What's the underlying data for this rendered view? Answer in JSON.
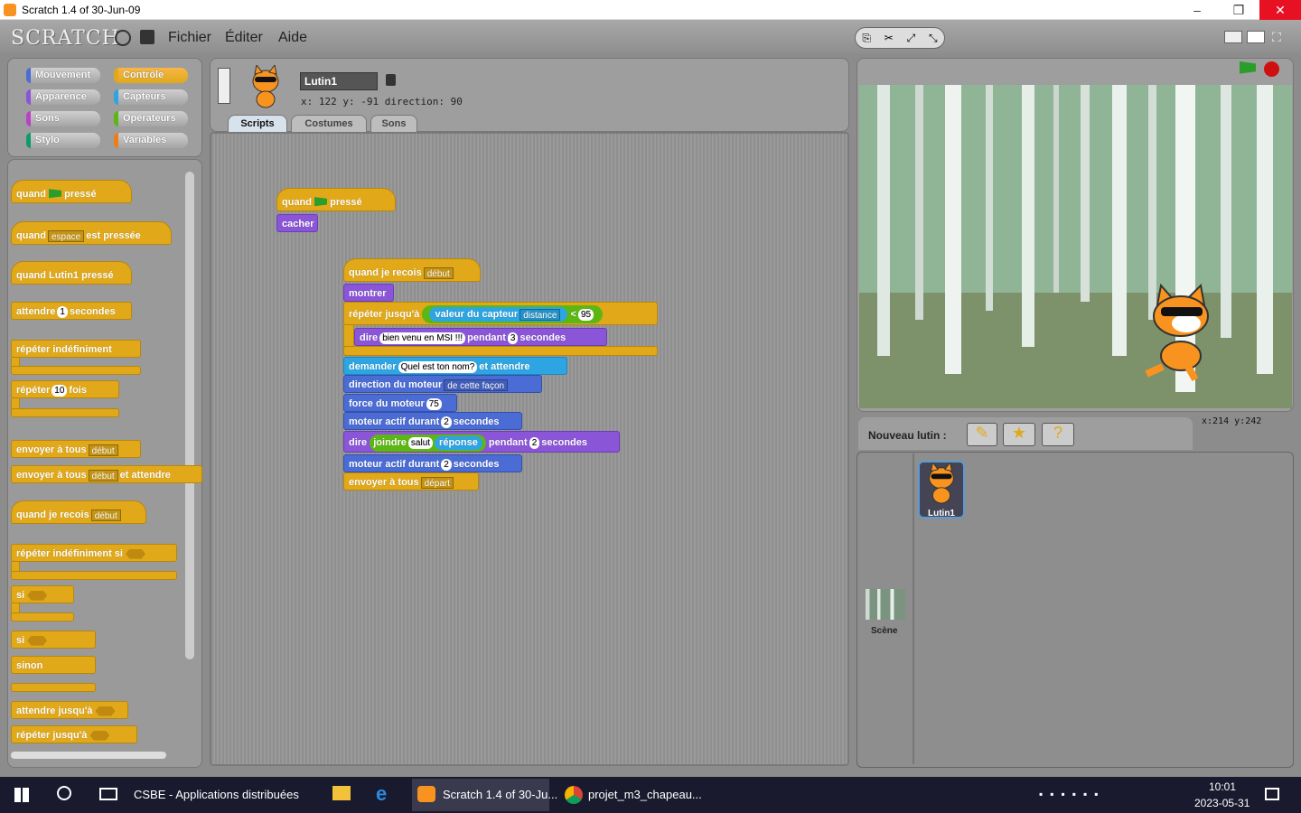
{
  "window": {
    "title": "Scratch 1.4 of 30-Jun-09",
    "minimize": "–",
    "restore": "❐",
    "close": "✕"
  },
  "menubar": {
    "logo": "SCRATCH",
    "file": "Fichier",
    "edit": "Éditer",
    "help": "Aide"
  },
  "categories": {
    "motion": "Mouvement",
    "looks": "Apparence",
    "sound": "Sons",
    "pen": "Stylo",
    "control": "Contrôle",
    "sensing": "Capteurs",
    "operators": "Opérateurs",
    "variables": "Variables"
  },
  "palette": {
    "when_flag": "quand",
    "pressed": "pressé",
    "when_key": "quand",
    "key": "espace",
    "key_pressed": "est pressée",
    "when_sprite": "quand Lutin1 pressé",
    "wait": "attendre",
    "wait_n": "1",
    "seconds": "secondes",
    "forever": "répéter indéfiniment",
    "repeat": "répéter",
    "repeat_n": "10",
    "times": "fois",
    "broadcast": "envoyer à tous",
    "broadcast_msg": "début",
    "broadcast_wait": "envoyer à tous",
    "broadcast_wait_msg": "début",
    "and_wait": "et attendre",
    "when_receive": "quand je recois",
    "receive_msg": "début",
    "forever_if": "répéter indéfiniment si",
    "if": "si",
    "if2": "si",
    "else": "sinon",
    "wait_until": "attendre jusqu'à",
    "repeat_until": "répéter jusqu'à"
  },
  "sprite": {
    "name": "Lutin1",
    "x_label": "x:",
    "x": "122",
    "y_label": "y:",
    "y": "-91",
    "dir_label": "direction:",
    "dir": "90"
  },
  "tabs": {
    "scripts": "Scripts",
    "costumes": "Costumes",
    "sounds": "Sons"
  },
  "script1": {
    "when": "quand",
    "pressed": "pressé",
    "hide": "cacher"
  },
  "script2": {
    "when_receive": "quand je recois",
    "msg": "début",
    "show": "montrer",
    "repeat_until": "répéter jusqu'à",
    "sensor_value": "valeur du capteur",
    "sensor": "distance",
    "lt": "<",
    "threshold": "95",
    "say": "dire",
    "say_text": "bien venu en MSI !!!",
    "for": "pendant",
    "say_secs": "3",
    "secs": "secondes",
    "ask": "demander",
    "ask_text": "Quel est ton nom?",
    "and_wait": "et attendre",
    "motor_dir": "direction du moteur",
    "motor_dir_val": "de cette façon",
    "motor_power": "force du moteur",
    "power": "75",
    "motor_on": "moteur actif durant",
    "motor_secs": "2",
    "secs2": "secondes",
    "say2": "dire",
    "join": "joindre",
    "join_a": "salut",
    "answer": "réponse",
    "for2": "pendant",
    "say2_secs": "2",
    "secs3": "secondes",
    "motor_on2": "moteur actif durant",
    "motor_secs2": "2",
    "secs4": "secondes",
    "broadcast": "envoyer à tous",
    "broadcast_msg": "départ"
  },
  "stage_footer": {
    "new_sprite": "Nouveau lutin :",
    "x_label": "x:",
    "x": "214",
    "y_label": "y:",
    "y": "242"
  },
  "sprites": {
    "sprite1": "Lutin1",
    "stage": "Scène"
  },
  "taskbar": {
    "app1": "CSBE - Applications distribuées",
    "app2": "Scratch 1.4 of 30-Ju...",
    "app3": "projet_m3_chapeau...",
    "time": "10:01",
    "date": "2023-05-31"
  },
  "colors": {
    "control": "#e1a91a",
    "looks": "#8a55d7",
    "sensing": "#2ca5e2",
    "motion": "#4a6cd4",
    "operators": "#5cb712"
  }
}
